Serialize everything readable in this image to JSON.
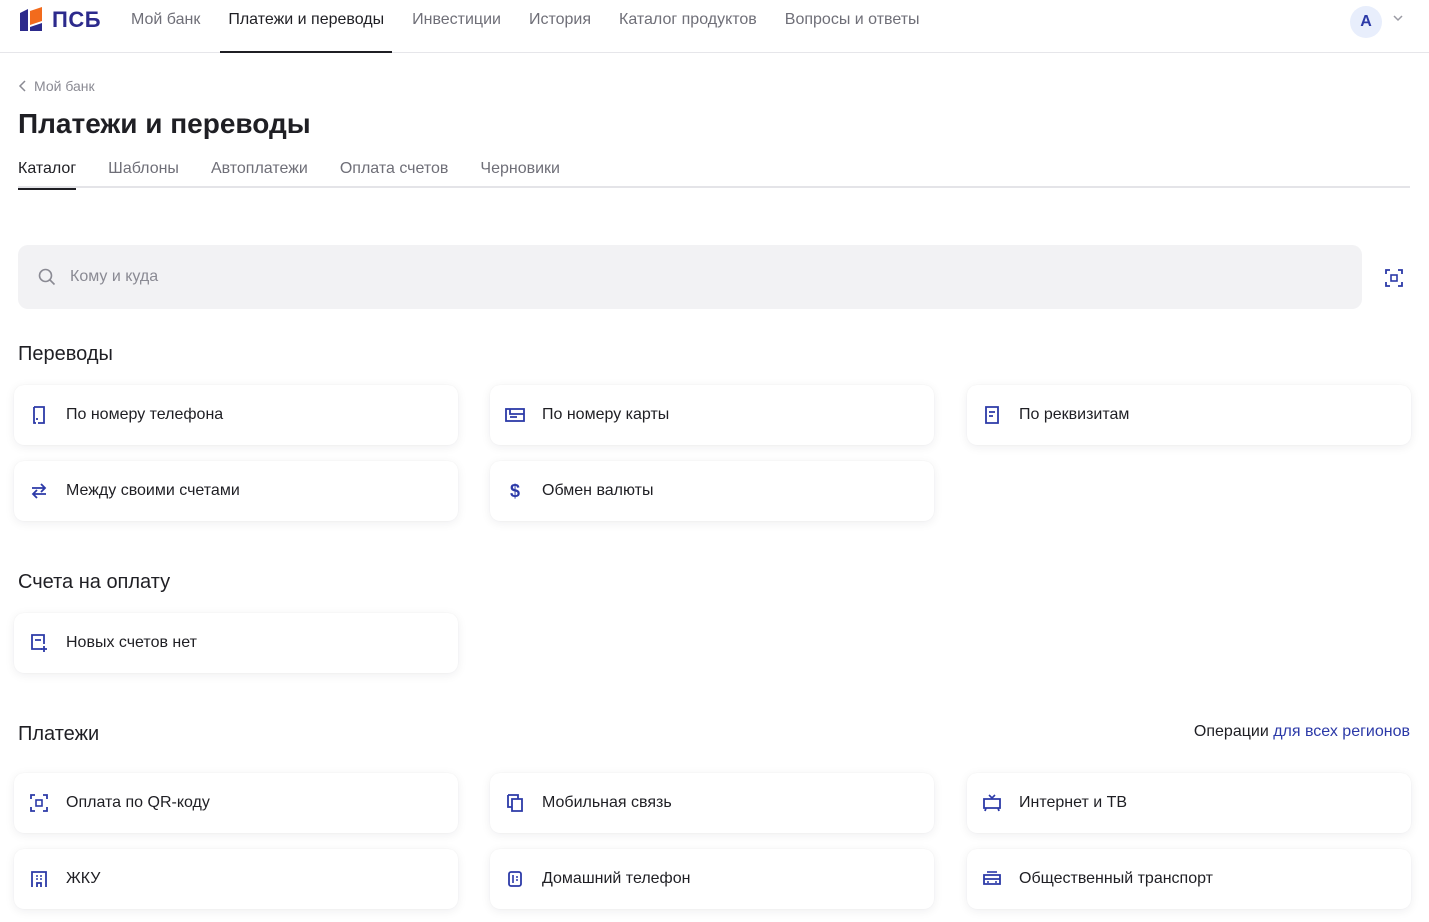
{
  "brand": {
    "name": "ПСБ",
    "accent": "#2c2a8c",
    "orange": "#f26b1d"
  },
  "nav": {
    "items": [
      {
        "label": "Мой банк"
      },
      {
        "label": "Платежи и переводы"
      },
      {
        "label": "Инвестиции"
      },
      {
        "label": "История"
      },
      {
        "label": "Каталог продуктов"
      },
      {
        "label": "Вопросы и ответы"
      }
    ],
    "active": "Платежи и переводы",
    "avatar_initial": "А"
  },
  "breadcrumb": {
    "label": "Мой банк"
  },
  "page": {
    "title": "Платежи и переводы"
  },
  "tabs": [
    {
      "label": "Каталог"
    },
    {
      "label": "Шаблоны"
    },
    {
      "label": "Автоплатежи"
    },
    {
      "label": "Оплата счетов"
    },
    {
      "label": "Черновики"
    }
  ],
  "active_tab": "Каталог",
  "search": {
    "placeholder": "Кому и куда",
    "value": ""
  },
  "sections": {
    "transfers": {
      "title": "Переводы",
      "items": [
        {
          "label": "По номеру телефона",
          "icon": "phone-icon"
        },
        {
          "label": "По номеру карты",
          "icon": "card-icon"
        },
        {
          "label": "По реквизитам",
          "icon": "document-icon"
        },
        {
          "label": "Между своими счетами",
          "icon": "swap-arrows-icon"
        },
        {
          "label": "Обмен валюты",
          "icon": "dollar-icon"
        }
      ]
    },
    "bills": {
      "title": "Счета на оплату",
      "items": [
        {
          "label": "Новых счетов нет",
          "icon": "invoice-add-icon"
        }
      ]
    },
    "payments": {
      "title": "Платежи",
      "regions_prefix": "Операции",
      "regions_link": "для всех регионов",
      "items": [
        {
          "label": "Оплата по QR-коду",
          "icon": "qr-code-icon"
        },
        {
          "label": "Мобильная связь",
          "icon": "mobile-icon"
        },
        {
          "label": "Интернет и ТВ",
          "icon": "tv-icon"
        },
        {
          "label": "ЖКУ",
          "icon": "building-icon"
        },
        {
          "label": "Домашний телефон",
          "icon": "home-phone-icon"
        },
        {
          "label": "Общественный транспорт",
          "icon": "bus-icon"
        }
      ]
    }
  }
}
